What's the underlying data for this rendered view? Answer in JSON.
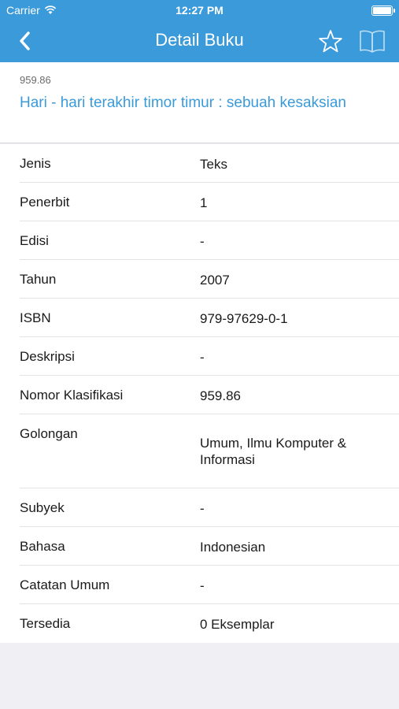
{
  "status_bar": {
    "carrier": "Carrier",
    "time": "12:27 PM"
  },
  "nav": {
    "title": "Detail Buku",
    "back_icon": "chevron-left-icon",
    "favorite_icon": "star-outline-icon",
    "read_icon": "open-book-icon"
  },
  "book": {
    "code": "959.86",
    "title": "Hari - hari terakhir timor timur : sebuah kesaksian"
  },
  "details": [
    {
      "label": "Jenis",
      "value": "Teks"
    },
    {
      "label": "Penerbit",
      "value": "1"
    },
    {
      "label": "Edisi",
      "value": "-"
    },
    {
      "label": "Tahun",
      "value": "2007"
    },
    {
      "label": "ISBN",
      "value": "979-97629-0-1"
    },
    {
      "label": "Deskripsi",
      "value": "-"
    },
    {
      "label": "Nomor Klasifikasi",
      "value": "959.86"
    },
    {
      "label": "Golongan",
      "value": "Umum, Ilmu Komputer & Informasi"
    },
    {
      "label": "Subyek",
      "value": "-"
    },
    {
      "label": "Bahasa",
      "value": "Indonesian"
    },
    {
      "label": "Catatan Umum",
      "value": "-"
    },
    {
      "label": "Tersedia",
      "value": "0 Eksemplar"
    }
  ],
  "colors": {
    "accent": "#3b9ad9",
    "background": "#efeff4"
  }
}
